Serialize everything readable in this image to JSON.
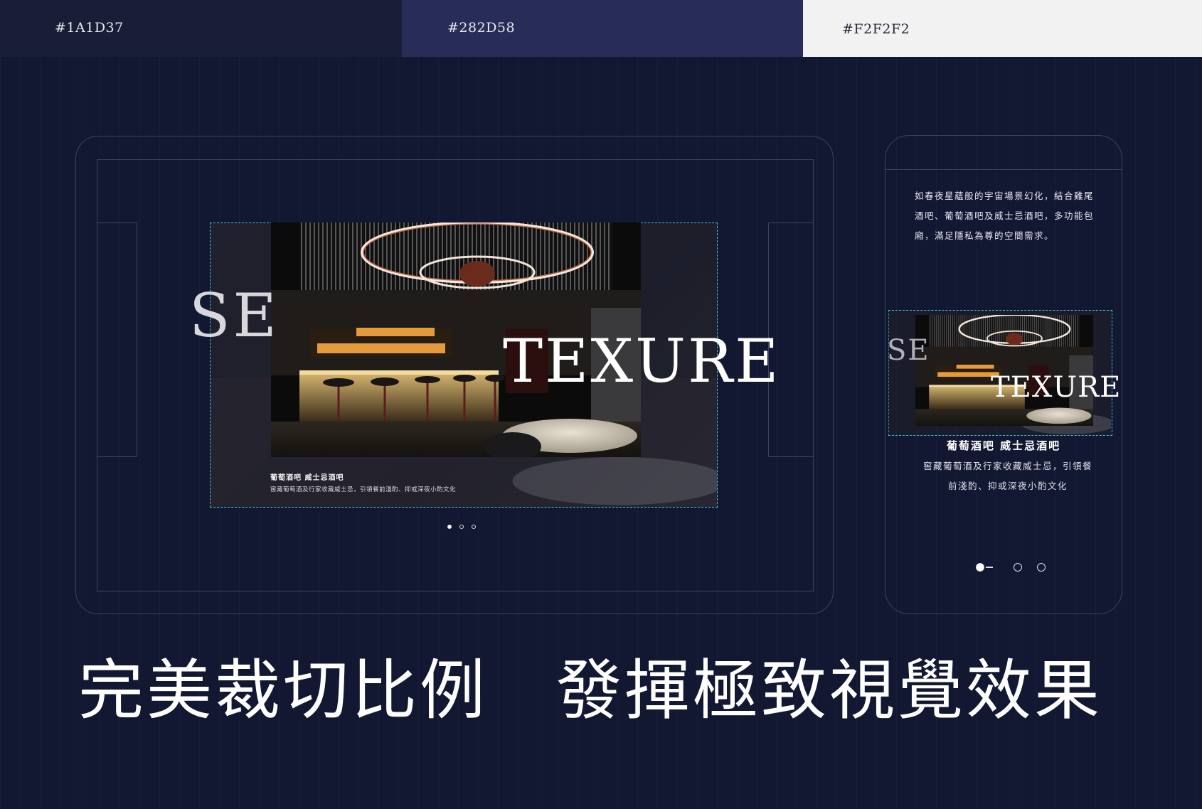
{
  "palette": {
    "swatches": [
      {
        "label": "#1A1D37",
        "color": "#1A1D37"
      },
      {
        "label": "#282D58",
        "color": "#282D58"
      },
      {
        "label": "#F2F2F2",
        "color": "#F2F2F2"
      }
    ]
  },
  "tablet": {
    "slide": {
      "word_left": "SE",
      "word_right": "TEXURE",
      "caption_title": "葡萄酒吧 威士忌酒吧",
      "caption_text": "窖藏葡萄酒及行家收藏威士忌，引領餐前淺酌、抑或深夜小酌文化"
    },
    "pagination": {
      "total": 3,
      "active": 0
    }
  },
  "phone": {
    "intro_lines": [
      "如春夜星蘊般的宇宙場景幻化，結合雞尾",
      "酒吧、葡萄酒吧及威士忌酒吧，多功能包",
      "廂，滿足隱私為尊的空間需求。"
    ],
    "slide": {
      "word_left": "SE",
      "word_right": "TEXURE"
    },
    "caption_title": "葡萄酒吧 威士忌酒吧",
    "caption_lines": [
      "窖藏葡萄酒及行家收藏威士忌，引領餐",
      "前淺酌、抑或深夜小酌文化"
    ],
    "pagination": {
      "total": 3,
      "active": 0
    }
  },
  "headline": "完美裁切比例　發揮極致視覺效果",
  "colors": {
    "background": "#131832",
    "frame_line": "#3c4162",
    "dashed_accent": "#3fc7d2"
  }
}
